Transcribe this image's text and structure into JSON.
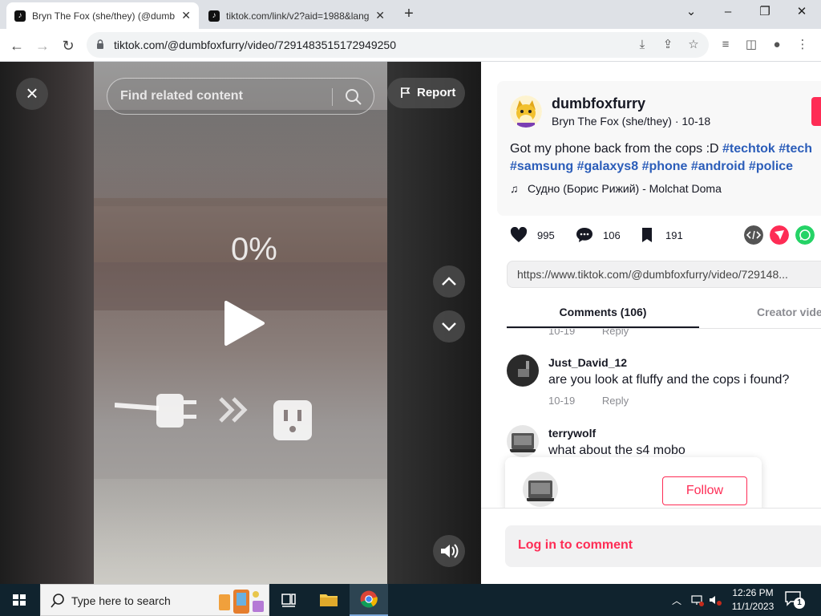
{
  "browser": {
    "tabs": [
      {
        "title": "Bryn The Fox (she/they) (@dumbfoxfurry)",
        "active": true
      },
      {
        "title": "tiktok.com/link/v2?aid=1988&lang",
        "active": false
      }
    ],
    "new_tab_label": "+",
    "url": "tiktok.com/@dumbfoxfurry/video/7291483515172949250"
  },
  "video": {
    "close_label": "×",
    "search_placeholder": "Find related content",
    "report_label": "Report",
    "progress_text": "0%"
  },
  "post": {
    "username": "dumbfoxfurry",
    "nickname": "Bryn The Fox (she/they)",
    "date": "10-18",
    "description_text": "Got my phone back from the cops :D",
    "hashtags": [
      "#techtok",
      "#tech",
      "#samsung",
      "#galaxys8",
      "#phone",
      "#android",
      "#police"
    ],
    "music": "Судно (Борис Рижий) - Molchat Doma",
    "likes": "995",
    "comments": "106",
    "saves": "191",
    "share_link": "https://www.tiktok.com/@dumbfoxfurry/video/729148..."
  },
  "tabs": {
    "comments_label": "Comments (106)",
    "creator_label": "Creator videos"
  },
  "comment_list": [
    {
      "user": "",
      "text": "",
      "date": "10-19",
      "reply_label": "Reply"
    },
    {
      "user": "Just_David_12",
      "text": "are you look at fluffy and the cops i found?",
      "date": "10-19",
      "reply_label": "Reply"
    },
    {
      "user": "terrywolf",
      "text": "what about the s4 mobo",
      "date": "",
      "reply_label": ""
    }
  ],
  "popup": {
    "follow_label": "Follow"
  },
  "login_label": "Log in to comment",
  "taskbar": {
    "search_placeholder": "Type here to search",
    "time": "12:26 PM",
    "date": "11/1/2023",
    "notification_count": "1"
  },
  "colors": {
    "accent": "#fe2c55",
    "hashtag": "#2b5db9",
    "taskbar": "#10232e"
  }
}
